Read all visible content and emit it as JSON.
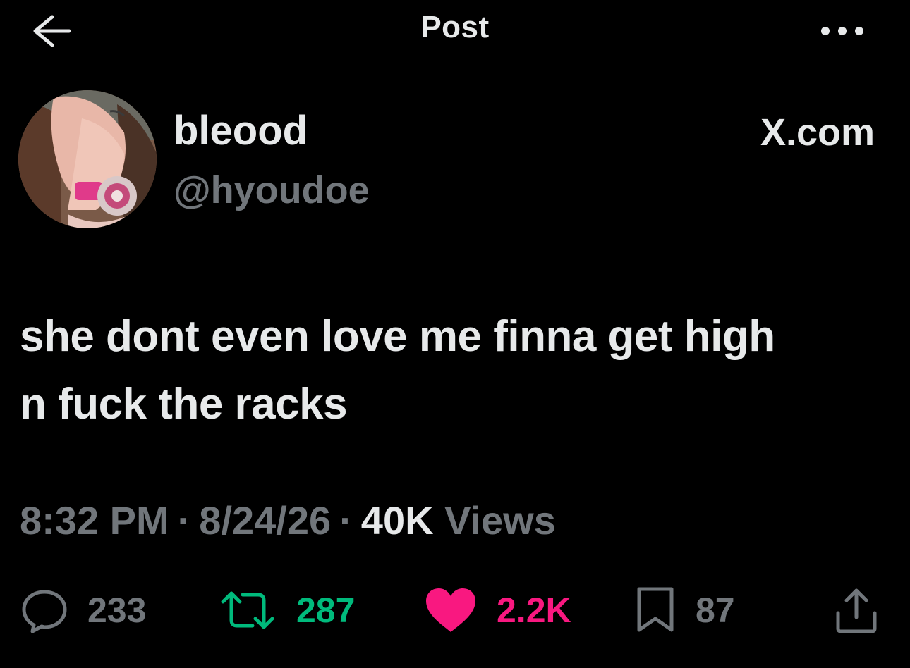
{
  "header": {
    "title": "Post",
    "back_icon": "arrow-left-icon",
    "more_icon": "more-horizontal-icon"
  },
  "author": {
    "display_name": "bleood",
    "handle": "@hyoudoe",
    "source": "X.com"
  },
  "post": {
    "text_line1": "she dont even love me finna get high",
    "text_line2": "n fuck the racks"
  },
  "meta": {
    "time": "8:32 PM",
    "date": "8/24/26",
    "views_count": "40K",
    "views_label": "Views",
    "separator": "·"
  },
  "actions": {
    "replies": "233",
    "reposts": "287",
    "likes": "2.2K",
    "bookmarks": "87"
  },
  "colors": {
    "background": "#000000",
    "text_primary": "#e7e9ea",
    "text_secondary": "#71767b",
    "repost_active": "#00ba7c",
    "like_active": "#f91880"
  }
}
